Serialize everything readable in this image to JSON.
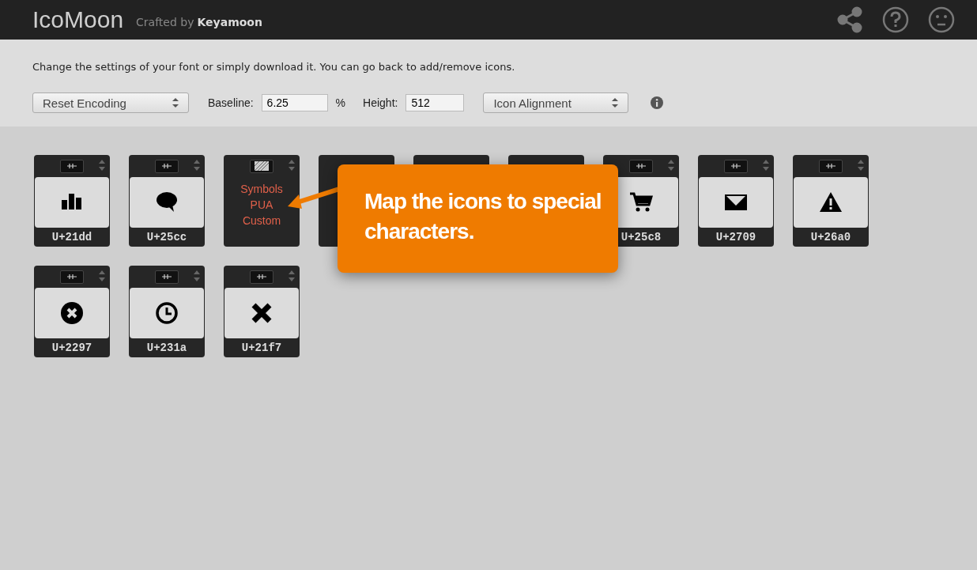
{
  "header": {
    "title": "IcoMoon",
    "tagline": "Crafted by",
    "author": "Keyamoon"
  },
  "intro": "Change the settings of your font or simply download it. You can go back to add/remove icons.",
  "toolbar": {
    "encoding_select": "Reset Encoding",
    "baseline_label": "Baseline:",
    "baseline_value": "6.25",
    "baseline_unit": "%",
    "height_label": "Height:",
    "height_value": "512",
    "alignment_select": "Icon Alignment"
  },
  "glyphs": [
    {
      "kind": "icon",
      "code": "U+21dd"
    },
    {
      "kind": "icon",
      "code": "U+25cc"
    },
    {
      "kind": "menu",
      "options": [
        "Symbols",
        "PUA",
        "Custom"
      ]
    },
    {
      "kind": "covered"
    },
    {
      "kind": "covered"
    },
    {
      "kind": "covered"
    },
    {
      "kind": "icon",
      "code": "U+25c8"
    },
    {
      "kind": "icon",
      "code": "U+2709"
    },
    {
      "kind": "icon",
      "code": "U+26a0"
    },
    {
      "kind": "icon",
      "code": "U+2297"
    },
    {
      "kind": "icon",
      "code": "U+231a"
    },
    {
      "kind": "icon",
      "code": "U+21f7"
    }
  ],
  "callout": {
    "text": "Map the icons to special characters."
  }
}
